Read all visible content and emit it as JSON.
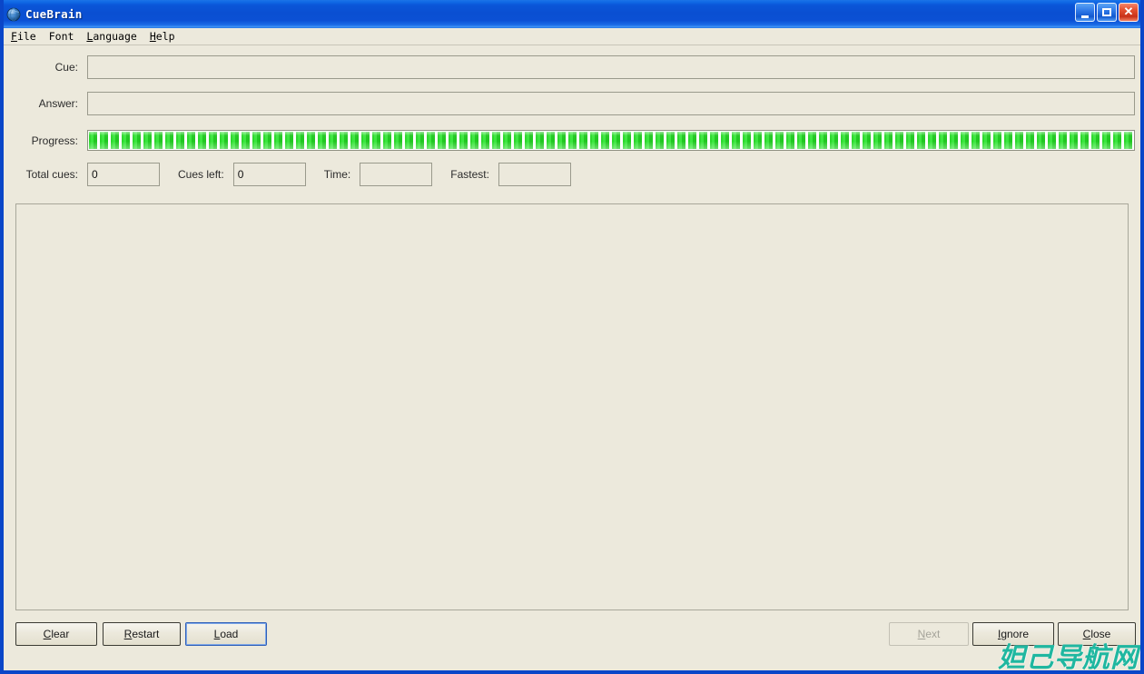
{
  "window": {
    "title": "CueBrain",
    "icon": "globe-icon",
    "controls": {
      "minimize": "minimize-icon",
      "maximize": "maximize-icon",
      "close": "close-icon"
    }
  },
  "menubar": {
    "items": [
      {
        "label": "File",
        "accel": "F"
      },
      {
        "label": "Font",
        "accel": ""
      },
      {
        "label": "Language",
        "accel": "L"
      },
      {
        "label": "Help",
        "accel": "H"
      }
    ]
  },
  "form": {
    "cue": {
      "label": "Cue:",
      "value": "",
      "placeholder": ""
    },
    "answer": {
      "label": "Answer:",
      "value": "",
      "placeholder": ""
    },
    "progress": {
      "label": "Progress:",
      "percent": 100
    },
    "stats": {
      "total_cues": {
        "label": "Total cues:",
        "value": "0"
      },
      "cues_left": {
        "label": "Cues left:",
        "value": "0"
      },
      "time": {
        "label": "Time:",
        "value": ""
      },
      "fastest": {
        "label": "Fastest:",
        "value": ""
      }
    }
  },
  "main_panel": {
    "content": ""
  },
  "buttons": {
    "clear": {
      "label": "Clear",
      "accel": "C",
      "state": "normal"
    },
    "restart": {
      "label": "Restart",
      "accel": "R",
      "state": "normal"
    },
    "load": {
      "label": "Load",
      "accel": "L",
      "state": "focused"
    },
    "next": {
      "label": "Next",
      "accel": "N",
      "state": "disabled"
    },
    "ignore": {
      "label": "Ignore",
      "accel": "I",
      "state": "normal"
    },
    "close": {
      "label": "Close",
      "accel": "C",
      "state": "normal"
    }
  },
  "watermark": {
    "text": "妲己导航网"
  },
  "colors": {
    "titlebar_blue": "#0a4fd2",
    "window_border": "#0a46c8",
    "background": "#ece9dc",
    "progress_green": "#2ad82a",
    "field_border": "#9a9a8c",
    "watermark": "#1fb7a0"
  }
}
